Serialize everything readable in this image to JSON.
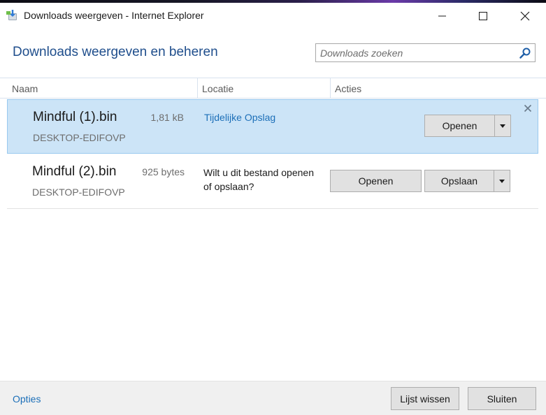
{
  "window": {
    "title": "Downloads weergeven - Internet Explorer"
  },
  "header": {
    "heading": "Downloads weergeven en beheren",
    "search_placeholder": "Downloads zoeken"
  },
  "columns": [
    "Naam",
    "Locatie",
    "Acties"
  ],
  "downloads": [
    {
      "name": "Mindful (1).bin",
      "size": "1,81 kB",
      "host": "DESKTOP-EDIFOVP",
      "location": "Tijdelijke Opslag",
      "open_label": "Openen",
      "selected": true
    },
    {
      "name": "Mindful (2).bin",
      "size": "925 bytes",
      "host": "DESKTOP-EDIFOVP",
      "prompt": "Wilt u dit bestand openen of opslaan?",
      "open_label": "Openen",
      "save_label": "Opslaan",
      "selected": false
    }
  ],
  "footer": {
    "options_label": "Opties",
    "clear_label": "Lijst wissen",
    "close_label": "Sluiten"
  },
  "icons": {
    "app": "ie-downloads-icon",
    "search": "search-icon",
    "row_close": "close-icon",
    "dropdown": "chevron-down-icon"
  },
  "colors": {
    "heading": "#1f4e8c",
    "link": "#1c6fb8",
    "selected_row_bg": "#cce4f7",
    "selected_row_border": "#99c9ef",
    "button_bg": "#e1e1e1",
    "footer_bg": "#f0f0f0"
  }
}
